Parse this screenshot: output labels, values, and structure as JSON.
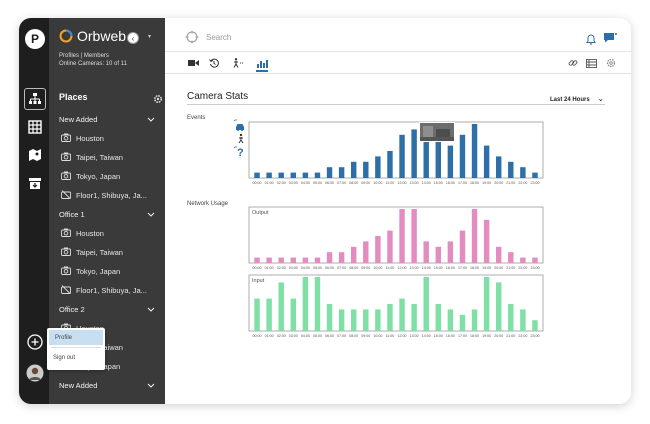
{
  "app": {
    "logo_letter": "P",
    "brand": "Orbweb",
    "profiles": "Profiles | Members",
    "online": "Online Cameras: 10 of 11"
  },
  "search": {
    "placeholder": "Search"
  },
  "sidebar": {
    "title": "Places",
    "groups": [
      {
        "label": "New Added",
        "items": [
          "Houston",
          "Taipei, Taiwan",
          "Tokyo, Japan",
          "Floor1, Shibuya, Ja..."
        ]
      },
      {
        "label": "Office 1",
        "items": [
          "Houston",
          "Taipei, Taiwan",
          "Tokyo, Japan",
          "Floor1, Shibuya, Ja..."
        ]
      },
      {
        "label": "Office 2",
        "items": [
          "Houston",
          "Taipei, Taiwan",
          "Tokyo, Japan"
        ]
      },
      {
        "label": "New Added",
        "items": []
      }
    ]
  },
  "popup": {
    "profile": "Profile",
    "signout": "Sign out"
  },
  "main": {
    "title": "Camera Stats",
    "range": "Last 24 Hours",
    "events_label": "Events",
    "network_label": "Network Usage"
  },
  "colors": {
    "events": "#2e6fa7",
    "output": "#e38cc0",
    "input": "#7ee0a5",
    "sidebar": "#3a3a3a",
    "rail": "#1e1e1e"
  },
  "chart_data": [
    {
      "type": "bar",
      "title": "Events",
      "categories": [
        "00:00",
        "01:00",
        "02:00",
        "03:00",
        "04:00",
        "05:00",
        "06:00",
        "07:00",
        "08:00",
        "09:00",
        "10:00",
        "11:00",
        "12:00",
        "13:00",
        "14:00",
        "15:00",
        "16:00",
        "17:00",
        "18:00",
        "19:00",
        "20:00",
        "21:00",
        "22:00",
        "23:00"
      ],
      "values": [
        1,
        1,
        1,
        1,
        1,
        1,
        2,
        2,
        3,
        3,
        4,
        5,
        8,
        9,
        10,
        7,
        6,
        8,
        10,
        6,
        4,
        3,
        2,
        1
      ],
      "ylim": [
        0,
        10
      ]
    },
    {
      "type": "bar",
      "title": "Output",
      "categories": [
        "00:00",
        "01:00",
        "02:00",
        "03:00",
        "04:00",
        "05:00",
        "06:00",
        "07:00",
        "08:00",
        "09:00",
        "10:00",
        "11:00",
        "12:00",
        "13:00",
        "14:00",
        "15:00",
        "16:00",
        "17:00",
        "18:00",
        "19:00",
        "20:00",
        "21:00",
        "22:00",
        "23:00"
      ],
      "values": [
        1,
        1,
        1,
        1,
        1,
        1,
        2,
        2,
        3,
        4,
        5,
        6,
        10,
        10,
        4,
        3,
        4,
        6,
        10,
        8,
        3,
        2,
        1,
        1
      ],
      "ylim": [
        0,
        10
      ]
    },
    {
      "type": "bar",
      "title": "Input",
      "categories": [
        "00:00",
        "01:00",
        "02:00",
        "03:00",
        "04:00",
        "05:00",
        "06:00",
        "07:00",
        "08:00",
        "09:00",
        "10:00",
        "11:00",
        "12:00",
        "13:00",
        "14:00",
        "15:00",
        "16:00",
        "17:00",
        "18:00",
        "19:00",
        "20:00",
        "21:00",
        "22:00",
        "23:00"
      ],
      "values": [
        6,
        6,
        9,
        6,
        10,
        10,
        5,
        4,
        4,
        4,
        4,
        5,
        6,
        5,
        10,
        5,
        4,
        3,
        4,
        10,
        9,
        5,
        4,
        2
      ],
      "ylim": [
        0,
        10
      ]
    }
  ]
}
